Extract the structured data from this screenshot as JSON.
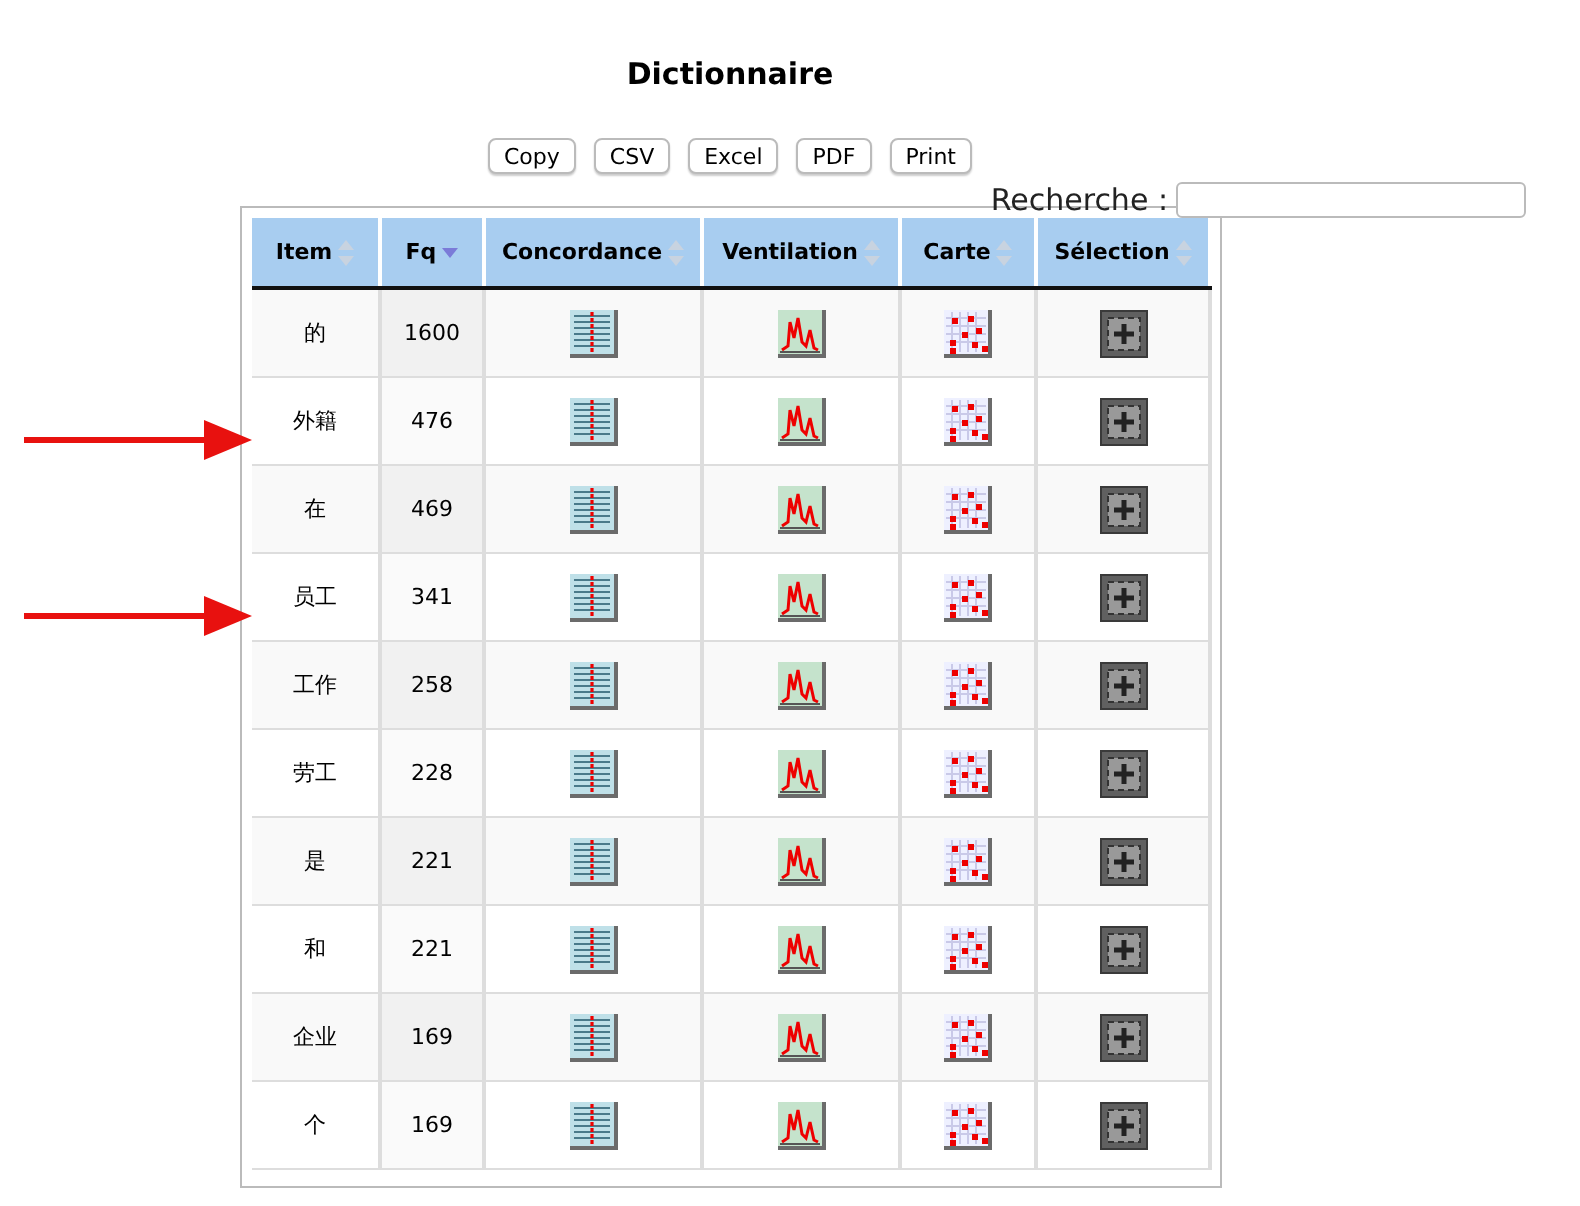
{
  "title": "Dictionnaire",
  "buttons": [
    "Copy",
    "CSV",
    "Excel",
    "PDF",
    "Print"
  ],
  "search": {
    "label": "Recherche :"
  },
  "columns": [
    {
      "label": "Item",
      "sorted": false
    },
    {
      "label": "Fq",
      "sorted": true
    },
    {
      "label": "Concordance",
      "sorted": false
    },
    {
      "label": "Ventilation",
      "sorted": false
    },
    {
      "label": "Carte",
      "sorted": false
    },
    {
      "label": "Sélection",
      "sorted": false
    }
  ],
  "rows": [
    {
      "item": "的",
      "fq": "1600",
      "arrow": false
    },
    {
      "item": "外籍",
      "fq": "476",
      "arrow": true
    },
    {
      "item": "在",
      "fq": "469",
      "arrow": false
    },
    {
      "item": "员工",
      "fq": "341",
      "arrow": true
    },
    {
      "item": "工作",
      "fq": "258",
      "arrow": false
    },
    {
      "item": "劳工",
      "fq": "228",
      "arrow": false
    },
    {
      "item": "是",
      "fq": "221",
      "arrow": false
    },
    {
      "item": "和",
      "fq": "221",
      "arrow": false
    },
    {
      "item": "企业",
      "fq": "169",
      "arrow": false
    },
    {
      "item": "个",
      "fq": "169",
      "arrow": false
    }
  ]
}
